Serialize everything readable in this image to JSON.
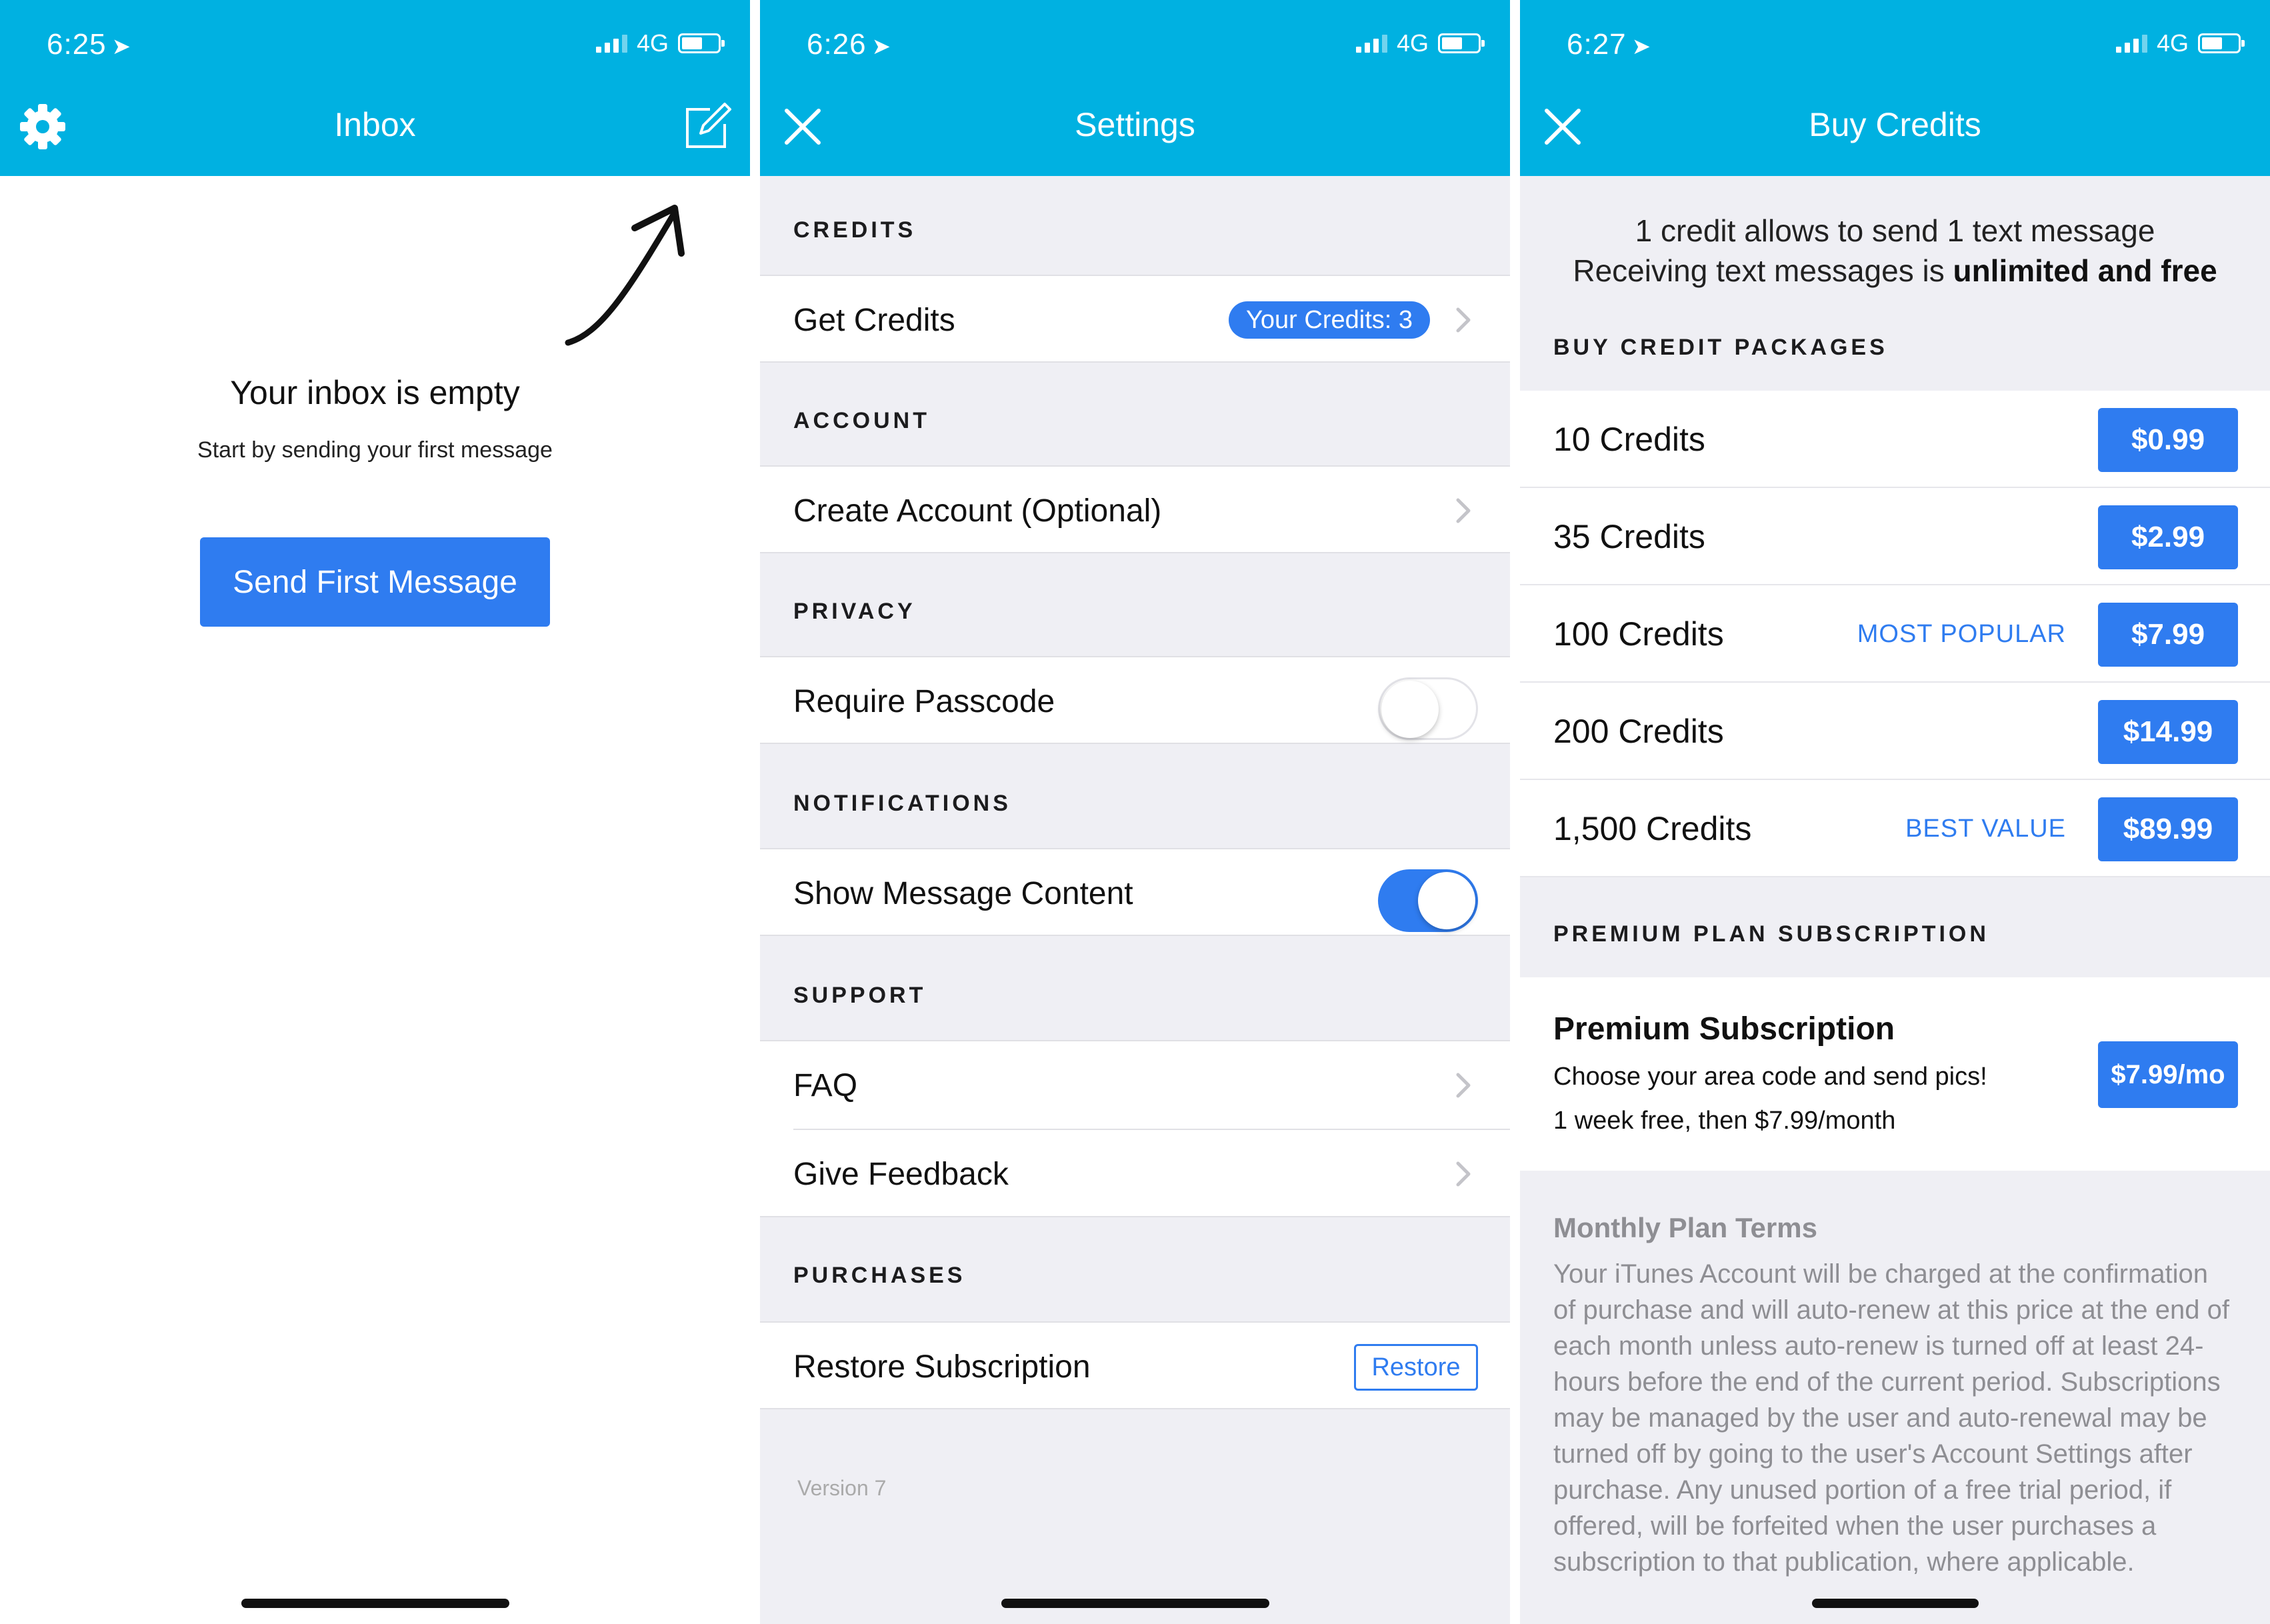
{
  "colors": {
    "header": "#00b1e1",
    "accent": "#2f7cf0",
    "group_bg": "#efeff4"
  },
  "screens": [
    {
      "status": {
        "time": "6:25",
        "network": "4G"
      },
      "nav": {
        "title": "Inbox",
        "left_icon": "gear-icon",
        "right_icon": "compose-icon"
      },
      "empty_title": "Your inbox is empty",
      "empty_subtitle": "Start by sending your first message",
      "primary_button": "Send First Message"
    },
    {
      "status": {
        "time": "6:26",
        "network": "4G"
      },
      "nav": {
        "title": "Settings",
        "left_icon": "close-icon"
      },
      "sections": [
        {
          "header": "CREDITS",
          "rows": [
            {
              "label": "Get Credits",
              "badge": "Your Credits: 3"
            }
          ]
        },
        {
          "header": "ACCOUNT",
          "rows": [
            {
              "label": "Create Account (Optional)"
            }
          ]
        },
        {
          "header": "PRIVACY",
          "rows": [
            {
              "label": "Require Passcode",
              "toggle": false
            }
          ]
        },
        {
          "header": "NOTIFICATIONS",
          "rows": [
            {
              "label": "Show Message Content",
              "toggle": true
            }
          ]
        },
        {
          "header": "SUPPORT",
          "rows": [
            {
              "label": "FAQ"
            },
            {
              "label": "Give Feedback"
            }
          ]
        },
        {
          "header": "PURCHASES",
          "rows": [
            {
              "label": "Restore Subscription",
              "button": "Restore"
            }
          ]
        }
      ],
      "version": "Version 7"
    },
    {
      "status": {
        "time": "6:27",
        "network": "4G"
      },
      "nav": {
        "title": "Buy Credits",
        "left_icon": "close-icon"
      },
      "intro_line1": "1 credit allows to send 1 text message",
      "intro_line2_prefix": "Receiving text messages is ",
      "intro_line2_bold": "unlimited and free",
      "packages_header": "BUY CREDIT PACKAGES",
      "packages": [
        {
          "label": "10 Credits",
          "price": "$0.99",
          "tag": ""
        },
        {
          "label": "35 Credits",
          "price": "$2.99",
          "tag": ""
        },
        {
          "label": "100 Credits",
          "price": "$7.99",
          "tag": "MOST POPULAR"
        },
        {
          "label": "200 Credits",
          "price": "$14.99",
          "tag": ""
        },
        {
          "label": "1,500 Credits",
          "price": "$89.99",
          "tag": "BEST VALUE"
        }
      ],
      "premium_header": "PREMIUM PLAN SUBSCRIPTION",
      "premium_title": "Premium Subscription",
      "premium_subtitle": "Choose your area code and send pics!",
      "premium_trial": "1 week free, then $7.99/month",
      "premium_price": "$7.99/mo",
      "terms_title": "Monthly Plan Terms",
      "terms_body": "Your iTunes Account will be charged at the confirmation of purchase and will auto-renew at this price at the end of each month unless auto-renew is turned off at least 24-hours before the end of the current period. Subscriptions may be managed by the user and auto-renewal may be turned off by going to the user's Account Settings after purchase. Any unused portion of a free trial period, if offered, will be forfeited when the user purchases a subscription to that publication, where applicable."
    }
  ]
}
